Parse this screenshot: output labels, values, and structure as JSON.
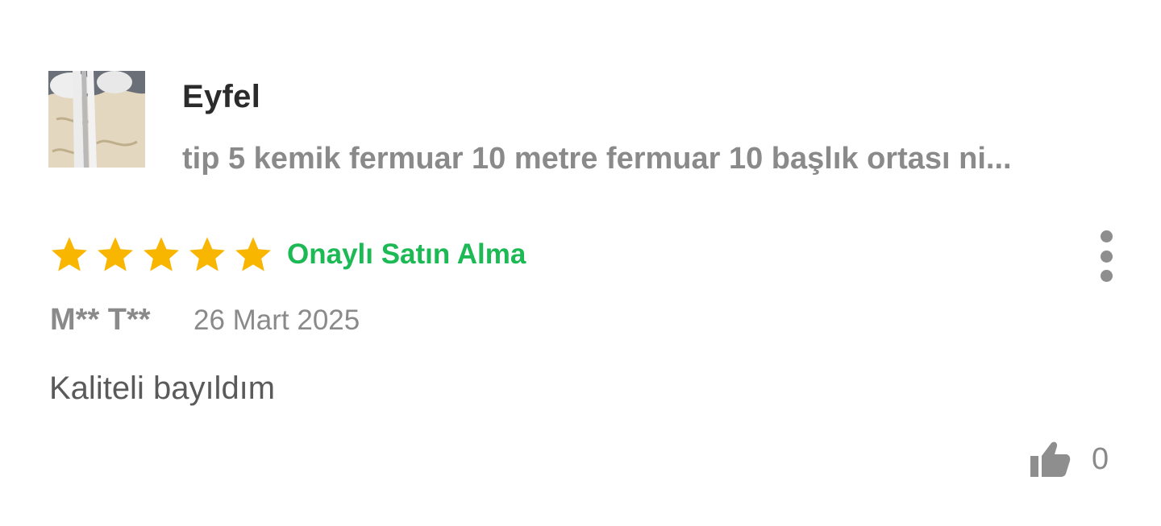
{
  "review": {
    "seller_name": "Eyfel",
    "product_title": "tip 5 kemik fermuar 10 metre fermuar 10 başlık ortası ni...",
    "rating": 5,
    "rating_max": 5,
    "verified_label": "Onaylı Satın Alma",
    "reviewer": "M** T**",
    "date": "26 Mart 2025",
    "text": "Kaliteli bayıldım",
    "like_count": "0",
    "colors": {
      "star": "#f8b600",
      "verified": "#1cb955",
      "muted_text": "#8a8a8a"
    },
    "icons": {
      "like": "thumbs-up-icon",
      "more": "more-vertical-icon",
      "star": "star-icon"
    }
  }
}
